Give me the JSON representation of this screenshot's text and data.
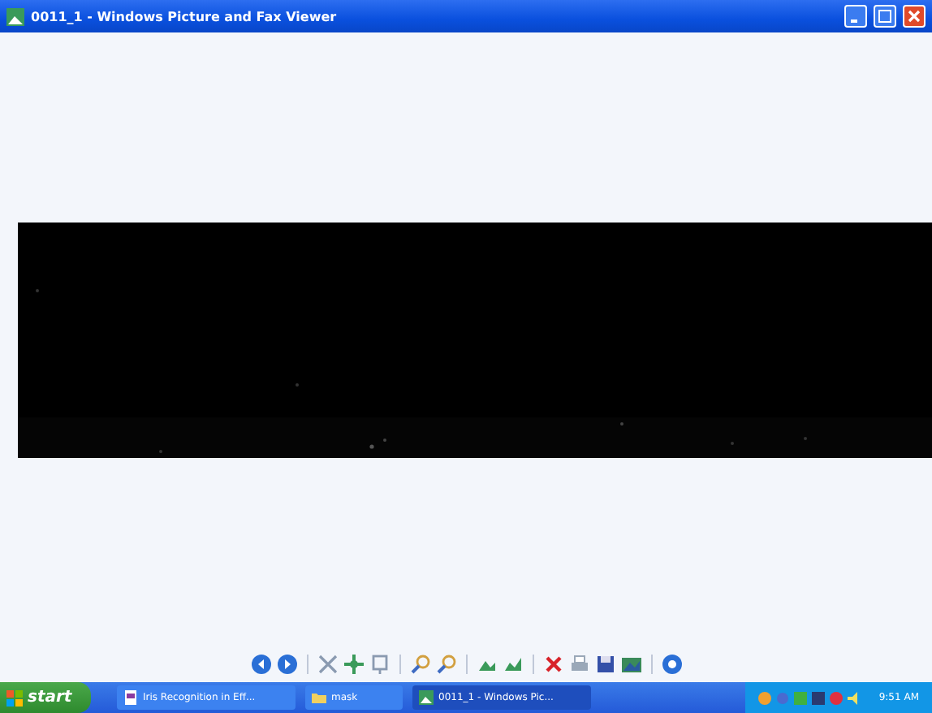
{
  "window": {
    "title": "0011_1 - Windows Picture and Fax Viewer"
  },
  "toolbar": {
    "groups": [
      {
        "buttons": [
          {
            "kind": "previous"
          },
          {
            "kind": "next"
          }
        ]
      },
      {
        "buttons": [
          {
            "kind": "best-fit"
          },
          {
            "kind": "actual-size"
          },
          {
            "kind": "slideshow"
          }
        ]
      },
      {
        "buttons": [
          {
            "kind": "zoom-in"
          },
          {
            "kind": "zoom-out"
          }
        ]
      },
      {
        "buttons": [
          {
            "kind": "rotate-clockwise"
          },
          {
            "kind": "rotate-counterclockwise"
          }
        ]
      },
      {
        "buttons": [
          {
            "kind": "delete"
          },
          {
            "kind": "print"
          },
          {
            "kind": "save"
          },
          {
            "kind": "edit"
          }
        ]
      },
      {
        "buttons": [
          {
            "kind": "help"
          }
        ]
      }
    ]
  },
  "taskbar": {
    "start": "start",
    "tasks": [
      {
        "label": "Iris Recognition in Eff...",
        "kind": "document",
        "selected": false
      },
      {
        "label": "mask",
        "kind": "folder",
        "selected": false
      },
      {
        "label": "0011_1 - Windows Pic...",
        "kind": "viewer",
        "selected": true
      }
    ],
    "clock": "9:51 AM"
  }
}
